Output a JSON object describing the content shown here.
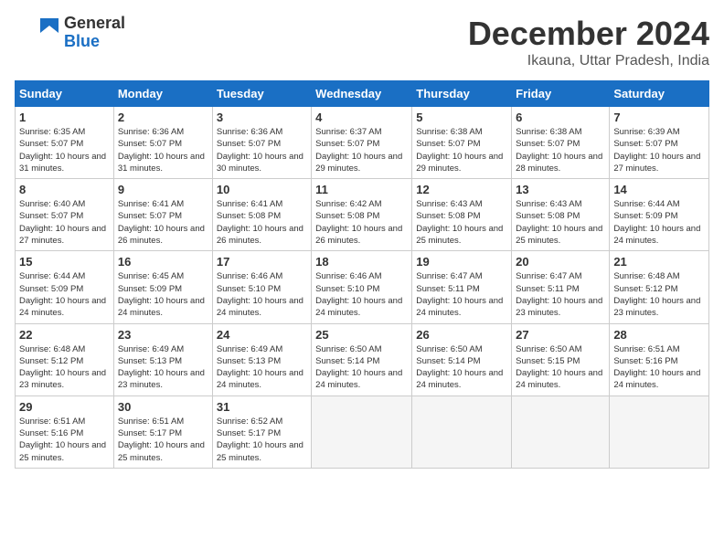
{
  "header": {
    "logo_general": "General",
    "logo_blue": "Blue",
    "month_title": "December 2024",
    "location": "Ikauna, Uttar Pradesh, India"
  },
  "columns": [
    "Sunday",
    "Monday",
    "Tuesday",
    "Wednesday",
    "Thursday",
    "Friday",
    "Saturday"
  ],
  "weeks": [
    [
      {
        "day": "1",
        "sunrise": "Sunrise: 6:35 AM",
        "sunset": "Sunset: 5:07 PM",
        "daylight": "Daylight: 10 hours and 31 minutes."
      },
      {
        "day": "2",
        "sunrise": "Sunrise: 6:36 AM",
        "sunset": "Sunset: 5:07 PM",
        "daylight": "Daylight: 10 hours and 31 minutes."
      },
      {
        "day": "3",
        "sunrise": "Sunrise: 6:36 AM",
        "sunset": "Sunset: 5:07 PM",
        "daylight": "Daylight: 10 hours and 30 minutes."
      },
      {
        "day": "4",
        "sunrise": "Sunrise: 6:37 AM",
        "sunset": "Sunset: 5:07 PM",
        "daylight": "Daylight: 10 hours and 29 minutes."
      },
      {
        "day": "5",
        "sunrise": "Sunrise: 6:38 AM",
        "sunset": "Sunset: 5:07 PM",
        "daylight": "Daylight: 10 hours and 29 minutes."
      },
      {
        "day": "6",
        "sunrise": "Sunrise: 6:38 AM",
        "sunset": "Sunset: 5:07 PM",
        "daylight": "Daylight: 10 hours and 28 minutes."
      },
      {
        "day": "7",
        "sunrise": "Sunrise: 6:39 AM",
        "sunset": "Sunset: 5:07 PM",
        "daylight": "Daylight: 10 hours and 27 minutes."
      }
    ],
    [
      {
        "day": "8",
        "sunrise": "Sunrise: 6:40 AM",
        "sunset": "Sunset: 5:07 PM",
        "daylight": "Daylight: 10 hours and 27 minutes."
      },
      {
        "day": "9",
        "sunrise": "Sunrise: 6:41 AM",
        "sunset": "Sunset: 5:07 PM",
        "daylight": "Daylight: 10 hours and 26 minutes."
      },
      {
        "day": "10",
        "sunrise": "Sunrise: 6:41 AM",
        "sunset": "Sunset: 5:08 PM",
        "daylight": "Daylight: 10 hours and 26 minutes."
      },
      {
        "day": "11",
        "sunrise": "Sunrise: 6:42 AM",
        "sunset": "Sunset: 5:08 PM",
        "daylight": "Daylight: 10 hours and 26 minutes."
      },
      {
        "day": "12",
        "sunrise": "Sunrise: 6:43 AM",
        "sunset": "Sunset: 5:08 PM",
        "daylight": "Daylight: 10 hours and 25 minutes."
      },
      {
        "day": "13",
        "sunrise": "Sunrise: 6:43 AM",
        "sunset": "Sunset: 5:08 PM",
        "daylight": "Daylight: 10 hours and 25 minutes."
      },
      {
        "day": "14",
        "sunrise": "Sunrise: 6:44 AM",
        "sunset": "Sunset: 5:09 PM",
        "daylight": "Daylight: 10 hours and 24 minutes."
      }
    ],
    [
      {
        "day": "15",
        "sunrise": "Sunrise: 6:44 AM",
        "sunset": "Sunset: 5:09 PM",
        "daylight": "Daylight: 10 hours and 24 minutes."
      },
      {
        "day": "16",
        "sunrise": "Sunrise: 6:45 AM",
        "sunset": "Sunset: 5:09 PM",
        "daylight": "Daylight: 10 hours and 24 minutes."
      },
      {
        "day": "17",
        "sunrise": "Sunrise: 6:46 AM",
        "sunset": "Sunset: 5:10 PM",
        "daylight": "Daylight: 10 hours and 24 minutes."
      },
      {
        "day": "18",
        "sunrise": "Sunrise: 6:46 AM",
        "sunset": "Sunset: 5:10 PM",
        "daylight": "Daylight: 10 hours and 24 minutes."
      },
      {
        "day": "19",
        "sunrise": "Sunrise: 6:47 AM",
        "sunset": "Sunset: 5:11 PM",
        "daylight": "Daylight: 10 hours and 24 minutes."
      },
      {
        "day": "20",
        "sunrise": "Sunrise: 6:47 AM",
        "sunset": "Sunset: 5:11 PM",
        "daylight": "Daylight: 10 hours and 23 minutes."
      },
      {
        "day": "21",
        "sunrise": "Sunrise: 6:48 AM",
        "sunset": "Sunset: 5:12 PM",
        "daylight": "Daylight: 10 hours and 23 minutes."
      }
    ],
    [
      {
        "day": "22",
        "sunrise": "Sunrise: 6:48 AM",
        "sunset": "Sunset: 5:12 PM",
        "daylight": "Daylight: 10 hours and 23 minutes."
      },
      {
        "day": "23",
        "sunrise": "Sunrise: 6:49 AM",
        "sunset": "Sunset: 5:13 PM",
        "daylight": "Daylight: 10 hours and 23 minutes."
      },
      {
        "day": "24",
        "sunrise": "Sunrise: 6:49 AM",
        "sunset": "Sunset: 5:13 PM",
        "daylight": "Daylight: 10 hours and 24 minutes."
      },
      {
        "day": "25",
        "sunrise": "Sunrise: 6:50 AM",
        "sunset": "Sunset: 5:14 PM",
        "daylight": "Daylight: 10 hours and 24 minutes."
      },
      {
        "day": "26",
        "sunrise": "Sunrise: 6:50 AM",
        "sunset": "Sunset: 5:14 PM",
        "daylight": "Daylight: 10 hours and 24 minutes."
      },
      {
        "day": "27",
        "sunrise": "Sunrise: 6:50 AM",
        "sunset": "Sunset: 5:15 PM",
        "daylight": "Daylight: 10 hours and 24 minutes."
      },
      {
        "day": "28",
        "sunrise": "Sunrise: 6:51 AM",
        "sunset": "Sunset: 5:16 PM",
        "daylight": "Daylight: 10 hours and 24 minutes."
      }
    ],
    [
      {
        "day": "29",
        "sunrise": "Sunrise: 6:51 AM",
        "sunset": "Sunset: 5:16 PM",
        "daylight": "Daylight: 10 hours and 25 minutes."
      },
      {
        "day": "30",
        "sunrise": "Sunrise: 6:51 AM",
        "sunset": "Sunset: 5:17 PM",
        "daylight": "Daylight: 10 hours and 25 minutes."
      },
      {
        "day": "31",
        "sunrise": "Sunrise: 6:52 AM",
        "sunset": "Sunset: 5:17 PM",
        "daylight": "Daylight: 10 hours and 25 minutes."
      },
      null,
      null,
      null,
      null
    ]
  ]
}
